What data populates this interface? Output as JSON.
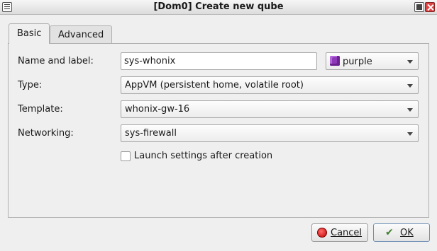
{
  "window": {
    "title": "[Dom0] Create new qube"
  },
  "tabs": [
    {
      "label": "Basic"
    },
    {
      "label": "Advanced"
    }
  ],
  "form": {
    "name_label": "Name and label:",
    "name_value": "sys-whonix",
    "qube_label_value": "purple",
    "qube_label_color": "#8e3ab8",
    "type_label": "Type:",
    "type_value": "AppVM (persistent home, volatile root)",
    "template_label": "Template:",
    "template_value": "whonix-gw-16",
    "networking_label": "Networking:",
    "networking_value": "sys-firewall",
    "launch_settings_label": "Launch settings after creation",
    "launch_settings_checked": false
  },
  "buttons": {
    "cancel_label": "Cancel",
    "ok_label": "OK"
  }
}
